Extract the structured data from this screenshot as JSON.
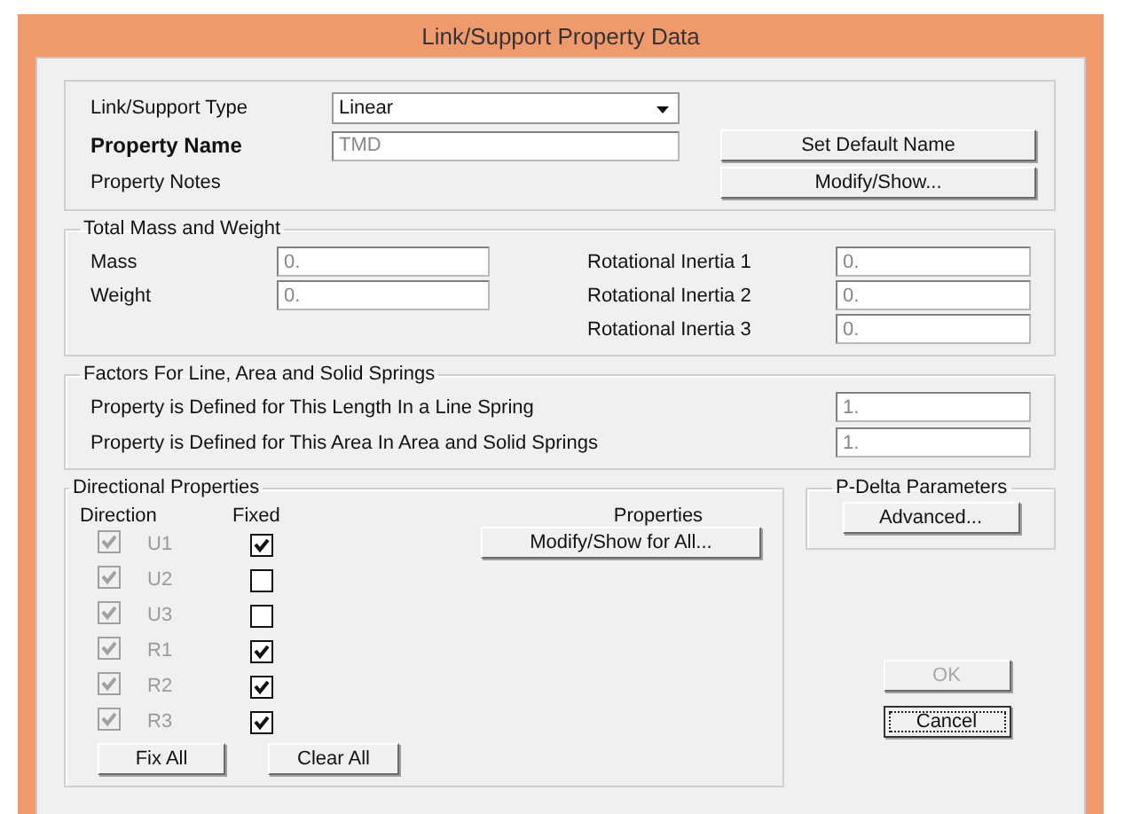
{
  "window": {
    "title": "Link/Support Property Data"
  },
  "general": {
    "type_label": "Link/Support Type",
    "type_value": "Linear",
    "name_label": "Property Name",
    "name_value": "TMD",
    "notes_label": "Property Notes",
    "buttons": [
      {
        "label": "Set Default Name"
      },
      {
        "label": "Modify/Show..."
      }
    ]
  },
  "mass": {
    "title": "Total Mass and Weight",
    "fields": [
      {
        "label": "Mass",
        "value": "0."
      },
      {
        "label": "Weight",
        "value": "0."
      }
    ],
    "inertia": [
      {
        "label": "Rotational Inertia 1",
        "value": "0."
      },
      {
        "label": "Rotational Inertia 2",
        "value": "0."
      },
      {
        "label": "Rotational Inertia 3",
        "value": "0."
      }
    ]
  },
  "factors": {
    "title": "Factors For Line, Area and Solid Springs",
    "rows": [
      {
        "label": "Property is Defined for This Length In a Line Spring",
        "value": "1."
      },
      {
        "label": "Property is Defined for This Area In Area and Solid Springs",
        "value": "1."
      }
    ]
  },
  "directional": {
    "title": "Directional Properties",
    "direction_heading": "Direction",
    "fixed_heading": "Fixed",
    "properties_heading": "Properties",
    "properties_button": "Modify/Show for All...",
    "rows": [
      {
        "label": "U1",
        "checked": true,
        "disabled": true,
        "fixed": true
      },
      {
        "label": "U2",
        "checked": true,
        "disabled": true,
        "fixed": false
      },
      {
        "label": "U3",
        "checked": true,
        "disabled": true,
        "fixed": false
      },
      {
        "label": "R1",
        "checked": true,
        "disabled": true,
        "fixed": true
      },
      {
        "label": "R2",
        "checked": true,
        "disabled": true,
        "fixed": true
      },
      {
        "label": "R3",
        "checked": true,
        "disabled": true,
        "fixed": true
      }
    ],
    "buttons": [
      {
        "label": "Fix All"
      },
      {
        "label": "Clear All"
      }
    ]
  },
  "pdelta": {
    "title": "P-Delta Parameters",
    "button": "Advanced..."
  },
  "actions": [
    {
      "label": "OK",
      "disabled": true,
      "focused": false
    },
    {
      "label": "Cancel",
      "disabled": false,
      "focused": true
    }
  ]
}
